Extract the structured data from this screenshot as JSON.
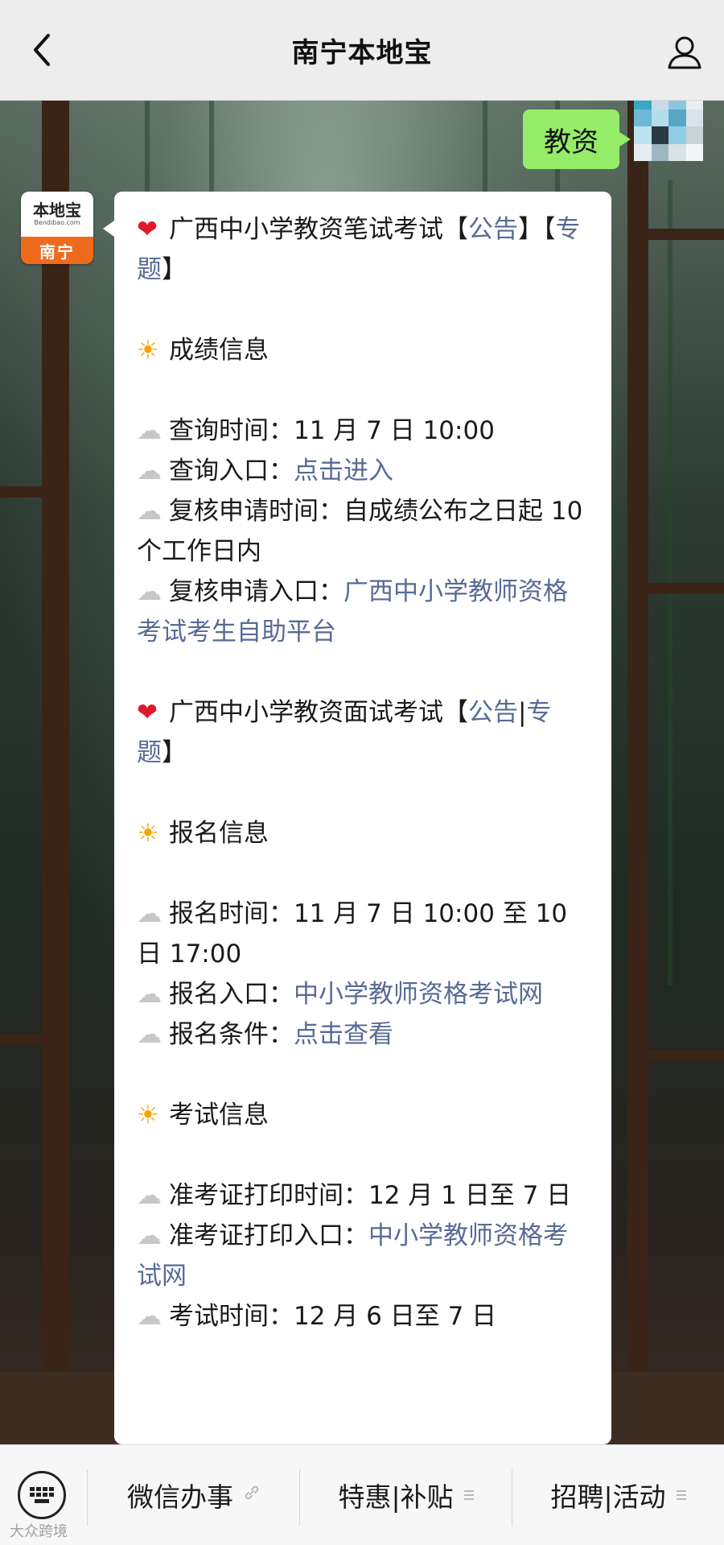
{
  "header": {
    "title": "南宁本地宝",
    "back_icon": "chevron-left-icon",
    "profile_icon": "person-icon"
  },
  "sent_message": {
    "text": "教资"
  },
  "official_avatar": {
    "brand": "本地宝",
    "brand_en": "Bendibao.com",
    "city": "南宁"
  },
  "message": {
    "lines": [
      {
        "type": "heart",
        "parts": [
          {
            "t": "广西中小学教资笔试考试【"
          },
          {
            "t": "公告",
            "link": true
          },
          {
            "t": "】【"
          },
          {
            "t": "专题",
            "link": true
          },
          {
            "t": "】"
          }
        ]
      },
      {
        "type": "gap"
      },
      {
        "type": "sun",
        "parts": [
          {
            "t": "成绩信息"
          }
        ]
      },
      {
        "type": "gap"
      },
      {
        "type": "cloud",
        "parts": [
          {
            "t": "查询时间：11 月 7 日 10:00"
          }
        ]
      },
      {
        "type": "cloud",
        "parts": [
          {
            "t": "查询入口："
          },
          {
            "t": "点击进入",
            "link": true
          }
        ]
      },
      {
        "type": "cloud",
        "parts": [
          {
            "t": "复核申请时间：自成绩公布之日起 10 个工作日内"
          }
        ]
      },
      {
        "type": "cloud",
        "parts": [
          {
            "t": "复核申请入口："
          },
          {
            "t": "广西中小学教师资格考试考生自助平台",
            "link": true
          }
        ]
      },
      {
        "type": "gap"
      },
      {
        "type": "heart",
        "parts": [
          {
            "t": "广西中小学教资面试考试【"
          },
          {
            "t": "公告",
            "link": true
          },
          {
            "t": "|"
          },
          {
            "t": "专题",
            "link": true
          },
          {
            "t": "】"
          }
        ]
      },
      {
        "type": "gap"
      },
      {
        "type": "sun",
        "parts": [
          {
            "t": "报名信息"
          }
        ]
      },
      {
        "type": "gap"
      },
      {
        "type": "cloud",
        "parts": [
          {
            "t": "报名时间：11 月 7 日 10:00 至 10日 17:00"
          }
        ]
      },
      {
        "type": "cloud",
        "parts": [
          {
            "t": "报名入口："
          },
          {
            "t": "中小学教师资格考试网",
            "link": true
          }
        ]
      },
      {
        "type": "cloud",
        "parts": [
          {
            "t": "报名条件："
          },
          {
            "t": "点击查看",
            "link": true
          }
        ]
      },
      {
        "type": "gap"
      },
      {
        "type": "sun",
        "parts": [
          {
            "t": "考试信息"
          }
        ]
      },
      {
        "type": "gap"
      },
      {
        "type": "cloud",
        "parts": [
          {
            "t": "准考证打印时间：12 月 1 日至 7 日"
          }
        ]
      },
      {
        "type": "cloud",
        "parts": [
          {
            "t": "准考证打印入口："
          },
          {
            "t": "中小学教师资格考试网",
            "link": true
          }
        ]
      },
      {
        "type": "cloud",
        "parts": [
          {
            "t": "考试时间：12 月 6 日至 7 日"
          }
        ]
      }
    ]
  },
  "bottom_menu": {
    "keyboard_icon": "keyboard-icon",
    "items": [
      {
        "label": "微信办事",
        "suffix_icon": "link-icon"
      },
      {
        "label": "特惠|补贴",
        "suffix_icon": "menu-lines-icon"
      },
      {
        "label": "招聘|活动",
        "suffix_icon": "menu-lines-icon"
      }
    ]
  },
  "watermark": "大众跨境",
  "colors": {
    "link": "#576b95",
    "sent_bubble": "#95ec69",
    "heart": "#e0192a",
    "sun": "#f5a300"
  }
}
